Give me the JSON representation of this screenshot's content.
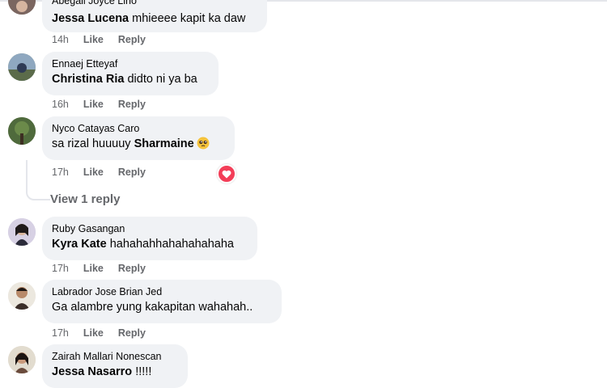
{
  "comments": [
    {
      "author": "Abegail Joyce Lino",
      "mention": "Jessa Lucena",
      "text": " mhieeee kapit ka daw",
      "time": "14h",
      "like": "Like",
      "reply": "Reply"
    },
    {
      "author": "Ennaej Etteyaf",
      "mention": "Christina Ria",
      "text": " didto ni ya ba",
      "time": "16h",
      "like": "Like",
      "reply": "Reply"
    },
    {
      "author": "Nyco Catayas Caro",
      "prefix": "sa rizal huuuuy ",
      "mention": "Sharmaine",
      "emoji": "pleading-face-emoji",
      "time": "17h",
      "like": "Like",
      "reply": "Reply",
      "reaction": "heart-icon",
      "view_replies": "View 1 reply"
    },
    {
      "author": "Ruby Gasangan",
      "mention": "Kyra Kate",
      "text": " hahahahhahahahahaha",
      "time": "17h",
      "like": "Like",
      "reply": "Reply"
    },
    {
      "author": "Labrador Jose Brian Jed",
      "text": "Ga alambre yung kakapitan wahahah..",
      "time": "17h",
      "like": "Like",
      "reply": "Reply"
    },
    {
      "author": "Zairah Mallari Nonescan",
      "mention": "Jessa Nasarro",
      "text": " !!!!!"
    }
  ],
  "colors": {
    "bubble": "#f0f2f5",
    "meta": "#65676b",
    "heart": "#f33e58"
  }
}
